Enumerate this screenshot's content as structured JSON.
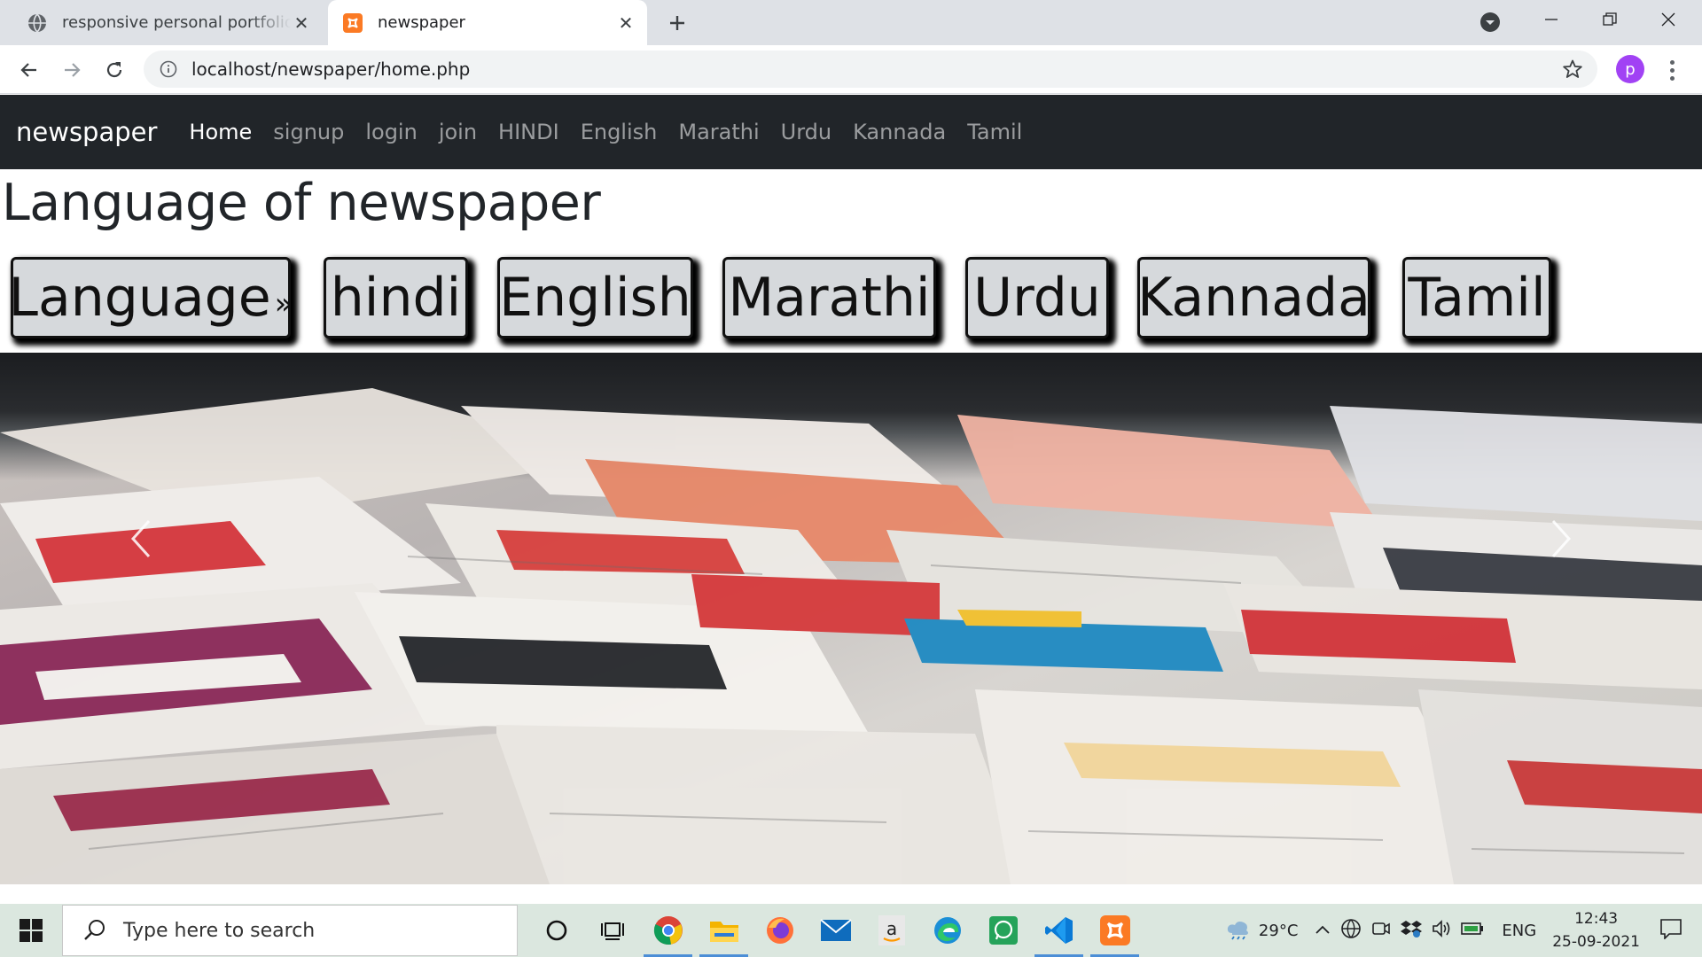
{
  "browser": {
    "tabs": [
      {
        "title": "responsive personal portfolio website",
        "active": false
      },
      {
        "title": "newspaper",
        "active": true
      }
    ],
    "url": "localhost/newspaper/home.php",
    "profile_initial": "p"
  },
  "site": {
    "brand": "newspaper",
    "nav": [
      "Home",
      "signup",
      "login",
      "join",
      "HINDI",
      "English",
      "Marathi",
      "Urdu",
      "Kannada",
      "Tamil"
    ],
    "heading": "Language of newspaper",
    "language_buttons": {
      "language": "Language",
      "raquo": "»",
      "hindi": "hindi",
      "english": "English",
      "marathi": "Marathi",
      "urdu": "Urdu",
      "kannada": "Kannada",
      "tamil": "Tamil"
    }
  },
  "taskbar": {
    "search_placeholder": "Type here to search",
    "weather": "29°C",
    "language": "ENG",
    "time": "12:43",
    "date": "25-09-2021"
  },
  "colors": {
    "navbar_bg": "#212529",
    "tab_strip": "#dee1e6",
    "taskbar_bg": "#dbe7df",
    "profile": "#a142f4"
  }
}
